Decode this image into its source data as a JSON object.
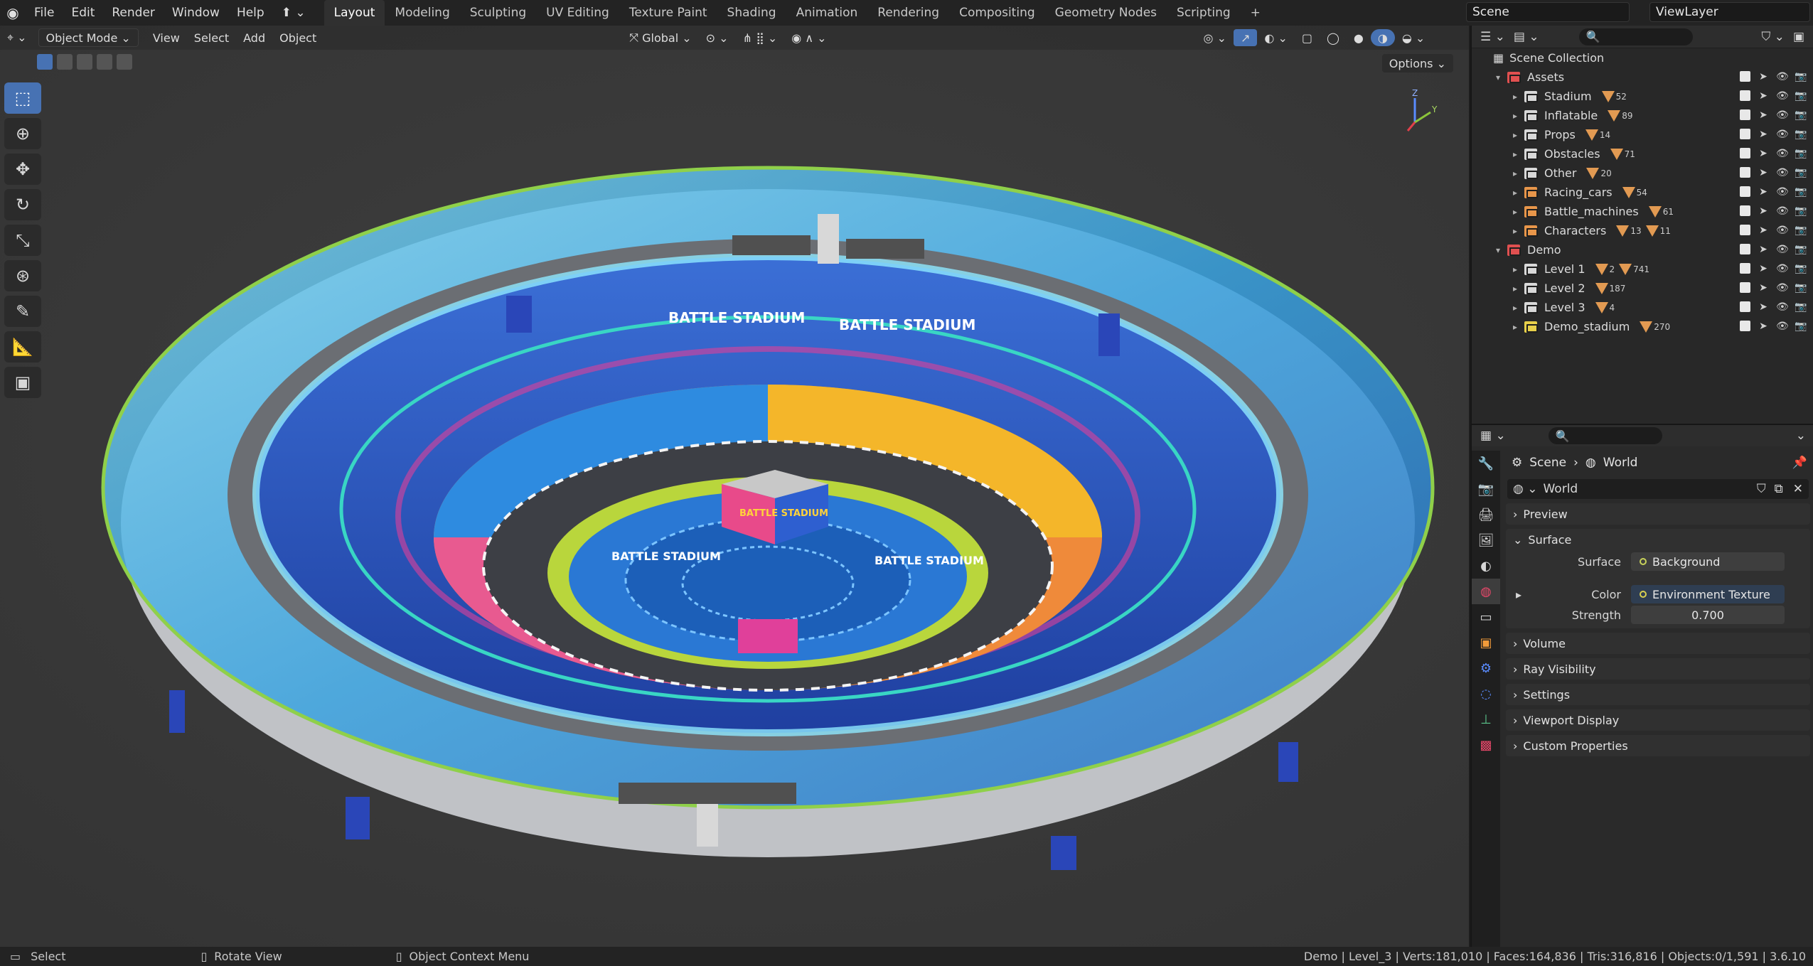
{
  "menu": [
    "File",
    "Edit",
    "Render",
    "Window",
    "Help"
  ],
  "workspaces": [
    "Layout",
    "Modeling",
    "Sculpting",
    "UV Editing",
    "Texture Paint",
    "Shading",
    "Animation",
    "Rendering",
    "Compositing",
    "Geometry Nodes",
    "Scripting"
  ],
  "active_workspace": "Layout",
  "scene_name": "Scene",
  "view_layer": "ViewLayer",
  "viewport": {
    "mode": "Object Mode",
    "menus": [
      "View",
      "Select",
      "Add",
      "Object"
    ],
    "orientation": "Global",
    "options_label": "Options",
    "gizmo_axes": {
      "z": "Z",
      "y": "Y"
    }
  },
  "scene_labels": {
    "banner": "BATTLE STADIUM",
    "cube_text": "BATTLE STADIUM"
  },
  "outliner": {
    "root": "Scene Collection",
    "items": [
      {
        "name": "Assets",
        "level": 0,
        "color": "#e05050",
        "badges": []
      },
      {
        "name": "Stadium",
        "level": 1,
        "color": "#d8d8d8",
        "badges": [
          "52"
        ]
      },
      {
        "name": "Inflatable",
        "level": 1,
        "color": "#d8d8d8",
        "badges": [
          "89"
        ]
      },
      {
        "name": "Props",
        "level": 1,
        "color": "#d8d8d8",
        "badges": [
          "14"
        ]
      },
      {
        "name": "Obstacles",
        "level": 1,
        "color": "#d8d8d8",
        "badges": [
          "71"
        ]
      },
      {
        "name": "Other",
        "level": 1,
        "color": "#d8d8d8",
        "badges": [
          "20"
        ]
      },
      {
        "name": "Racing_cars",
        "level": 1,
        "color": "#e8964a",
        "badges": [
          "54"
        ]
      },
      {
        "name": "Battle_machines",
        "level": 1,
        "color": "#e8964a",
        "badges": [
          "61"
        ]
      },
      {
        "name": "Characters",
        "level": 1,
        "color": "#e8964a",
        "badges": [
          "13",
          "11"
        ]
      },
      {
        "name": "Demo",
        "level": 0,
        "color": "#e05050",
        "badges": []
      },
      {
        "name": "Level 1",
        "level": 1,
        "color": "#d8d8d8",
        "badges": [
          "2",
          "741"
        ]
      },
      {
        "name": "Level 2",
        "level": 1,
        "color": "#d8d8d8",
        "badges": [
          "187"
        ]
      },
      {
        "name": "Level 3",
        "level": 1,
        "color": "#d8d8d8",
        "badges": [
          "4"
        ]
      },
      {
        "name": "Demo_stadium",
        "level": 1,
        "color": "#e8d04a",
        "badges": [
          "270"
        ]
      }
    ]
  },
  "properties": {
    "breadcrumb": [
      "Scene",
      "World"
    ],
    "world_name": "World",
    "panels": {
      "preview": "Preview",
      "surface": "Surface",
      "volume": "Volume",
      "ray_visibility": "Ray Visibility",
      "settings": "Settings",
      "viewport_display": "Viewport Display",
      "custom_properties": "Custom Properties"
    },
    "surface_label": "Surface",
    "surface_value": "Background",
    "color_label": "Color",
    "color_value": "Environment Texture",
    "strength_label": "Strength",
    "strength_value": "0.700"
  },
  "status": {
    "select": "Select",
    "rotate": "Rotate View",
    "context": "Object Context Menu",
    "stats": "Demo | Level_3 | Verts:181,010 | Faces:164,836 | Tris:316,816 | Objects:0/1,591 | 3.6.10"
  },
  "colors": {
    "accent": "#4772b3",
    "header": "#232323",
    "panel": "#2a2a2a"
  }
}
